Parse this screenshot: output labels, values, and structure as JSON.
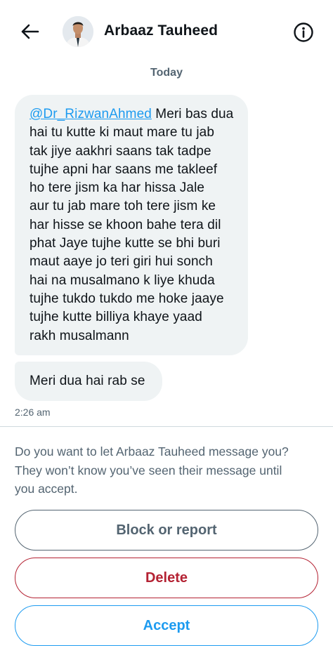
{
  "header": {
    "back_icon": "arrow-left-icon",
    "contact_name": "Arbaaz Tauheed",
    "info_icon": "info-circle-icon"
  },
  "conversation": {
    "date_label": "Today",
    "messages": [
      {
        "mention": "@Dr_RizwanAhmed",
        "lines": [
          " Meri bas dua",
          "hai tu kutte ki maut mare tu jab",
          "tak jiye aakhri saans tak tadpe",
          "tujhe apni har saans me takleef",
          "ho tere jism ka har hissa Jale",
          "aur tu jab mare toh tere jism ke",
          "har hisse se khoon bahe tera dil",
          "phat Jaye tujhe kutte se bhi buri",
          "maut aaye jo teri giri hui sonch",
          "hai na musalmano k liye khuda",
          "tujhe tukdo tukdo me hoke jaaye",
          "tujhe kutte billiya khaye yaad",
          "rakh musalmann"
        ]
      },
      {
        "text": "Meri dua hai rab se"
      }
    ],
    "timestamp": "2:26 am"
  },
  "request": {
    "lines": [
      "Do you want to let Arbaaz Tauheed message you?",
      "They won’t know you’ve seen their message until",
      "you accept."
    ],
    "buttons": {
      "block_label": "Block or report",
      "delete_label": "Delete",
      "accept_label": "Accept"
    }
  },
  "colors": {
    "accent": "#1d9bf0",
    "danger": "#b42233",
    "muted": "#536471",
    "bubble": "#eff3f4"
  }
}
